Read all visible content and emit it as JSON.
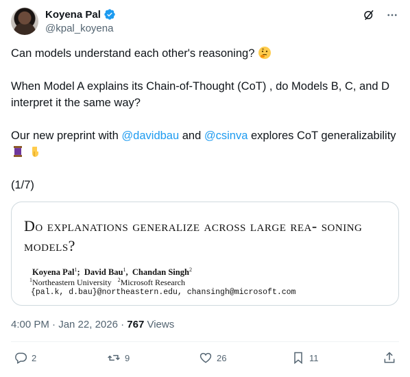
{
  "author": {
    "display_name": "Koyena Pal",
    "handle": "@kpal_koyena"
  },
  "tweet": {
    "line1": "Can models understand each other's reasoning?",
    "line2": "When Model A explains its Chain-of-Thought (CoT) , do Models B, C, and D interpret it the same way?",
    "line3_pre": "Our new preprint with",
    "mention1": "@davidbau",
    "line3_mid": "and",
    "mention2": "@csinva",
    "line3_post": "explores CoT generalizability",
    "line4": "(1/7)"
  },
  "paper": {
    "title": "Do explanations generalize across large rea- soning models?",
    "author1": "Koyena Pal",
    "author2": "David Bau",
    "author3": "Chandan Singh",
    "affil1": "Northeastern University",
    "affil2": "Microsoft Research",
    "emails": "{pal.k, d.bau}@northeastern.edu, chansingh@microsoft.com"
  },
  "meta": {
    "time": "4:00 PM · Jan 22, 2026 ·",
    "views_count": "767",
    "views_label": "Views"
  },
  "actions": {
    "replies": "2",
    "reposts": "9",
    "likes": "26",
    "bookmarks": "11"
  },
  "colors": {
    "accent": "#1d9bf0",
    "muted": "#536471"
  }
}
